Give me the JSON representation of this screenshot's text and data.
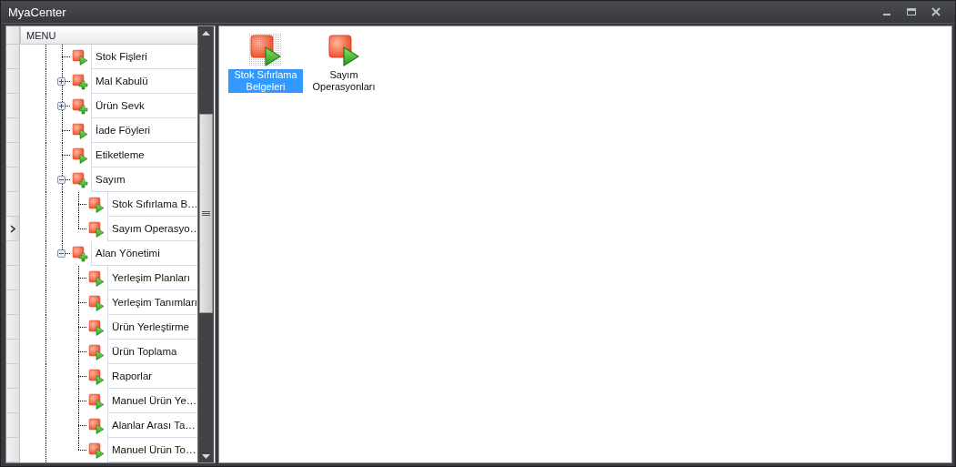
{
  "window": {
    "title": "MyaCenter"
  },
  "menu": {
    "header": "MENU",
    "items": [
      {
        "label": "Stok Fişleri",
        "kind": "leaf",
        "focused": false
      },
      {
        "label": "Mal Kabulü",
        "kind": "folder",
        "expanded": false,
        "focused": false
      },
      {
        "label": "Ürün Sevk",
        "kind": "folder",
        "expanded": false,
        "focused": false
      },
      {
        "label": "İade Föyleri",
        "kind": "leaf",
        "focused": false
      },
      {
        "label": "Etiketleme",
        "kind": "leaf",
        "focused": false
      },
      {
        "label": "Sayım",
        "kind": "folder",
        "expanded": true,
        "focused": false,
        "children": [
          {
            "label": "Stok Sıfırlama B…",
            "kind": "leaf",
            "focused": false
          },
          {
            "label": "Sayım Operasyo…",
            "kind": "leaf",
            "focused": true
          }
        ]
      },
      {
        "label": "Alan Yönetimi",
        "kind": "folder",
        "expanded": true,
        "focused": false,
        "children": [
          {
            "label": "Yerleşim Planları",
            "kind": "leaf",
            "focused": false
          },
          {
            "label": "Yerleşim Tanımları",
            "kind": "leaf",
            "focused": false
          },
          {
            "label": "Ürün Yerleştirme",
            "kind": "leaf",
            "focused": false
          },
          {
            "label": "Ürün Toplama",
            "kind": "leaf",
            "focused": false
          },
          {
            "label": "Raporlar",
            "kind": "leaf",
            "focused": false
          },
          {
            "label": "Manuel Ürün Ye…",
            "kind": "leaf",
            "focused": false
          },
          {
            "label": "Alanlar Arası Ta…",
            "kind": "leaf",
            "focused": false
          },
          {
            "label": "Manuel Ürün To…",
            "kind": "leaf",
            "focused": false
          }
        ]
      }
    ]
  },
  "content": {
    "items": [
      {
        "label": "Stok Sıfırlama Belgeleri",
        "selected": true
      },
      {
        "label": "Sayım Operasyonları",
        "selected": false
      }
    ]
  }
}
